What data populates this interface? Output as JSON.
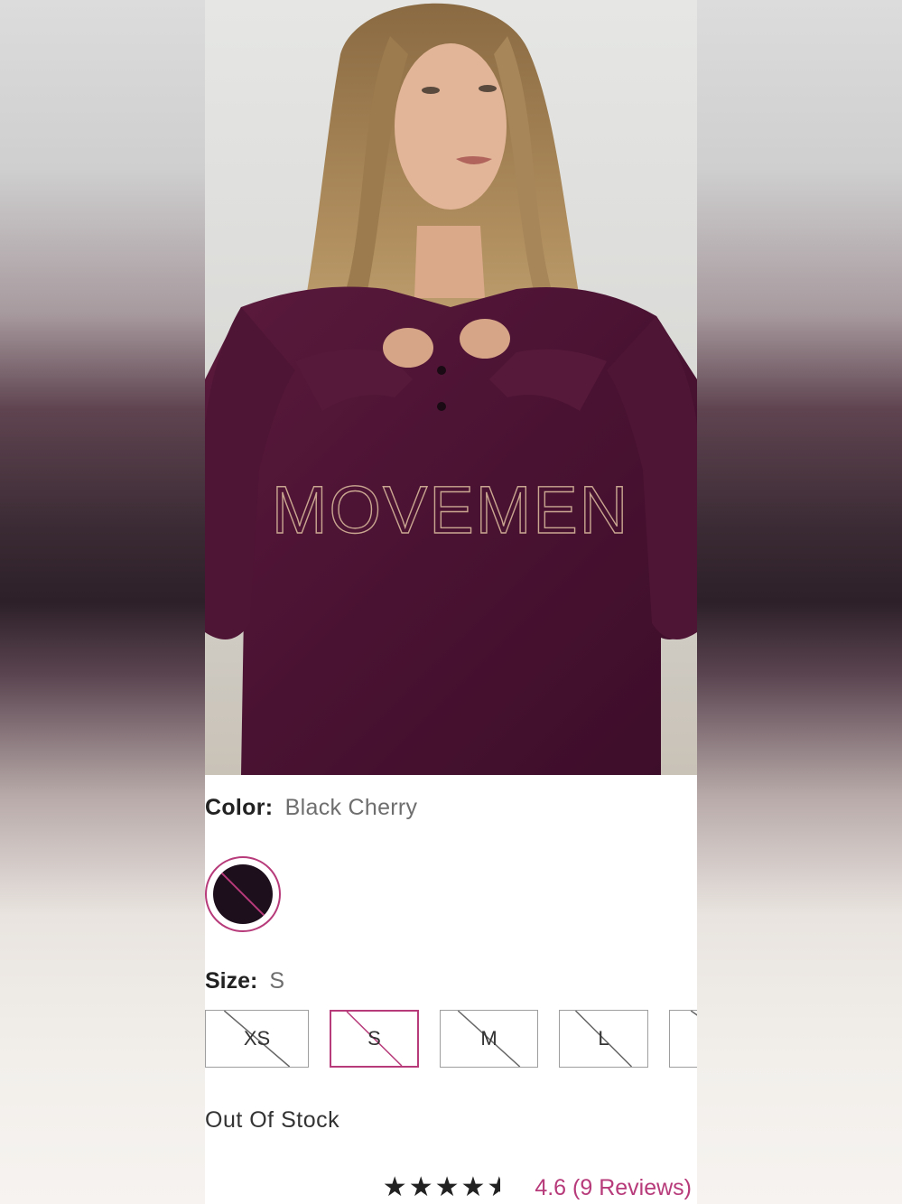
{
  "product": {
    "image_text": "MOVEMEN",
    "color_label": "Color:",
    "color_value": "Black Cherry",
    "swatch_color": "#1e0f1c",
    "accent_color": "#b73a7a",
    "size_label": "Size:",
    "size_value": "S",
    "sizes": [
      {
        "label": "XS",
        "selected": false,
        "available": false
      },
      {
        "label": "S",
        "selected": true,
        "available": false
      },
      {
        "label": "M",
        "selected": false,
        "available": false
      },
      {
        "label": "L",
        "selected": false,
        "available": false
      },
      {
        "label": "",
        "selected": false,
        "available": false
      }
    ],
    "stock_status": "Out Of Stock",
    "rating": {
      "stars_filled": 4.5,
      "stars_total": 5,
      "text": "4.6 (9 Reviews)"
    }
  }
}
